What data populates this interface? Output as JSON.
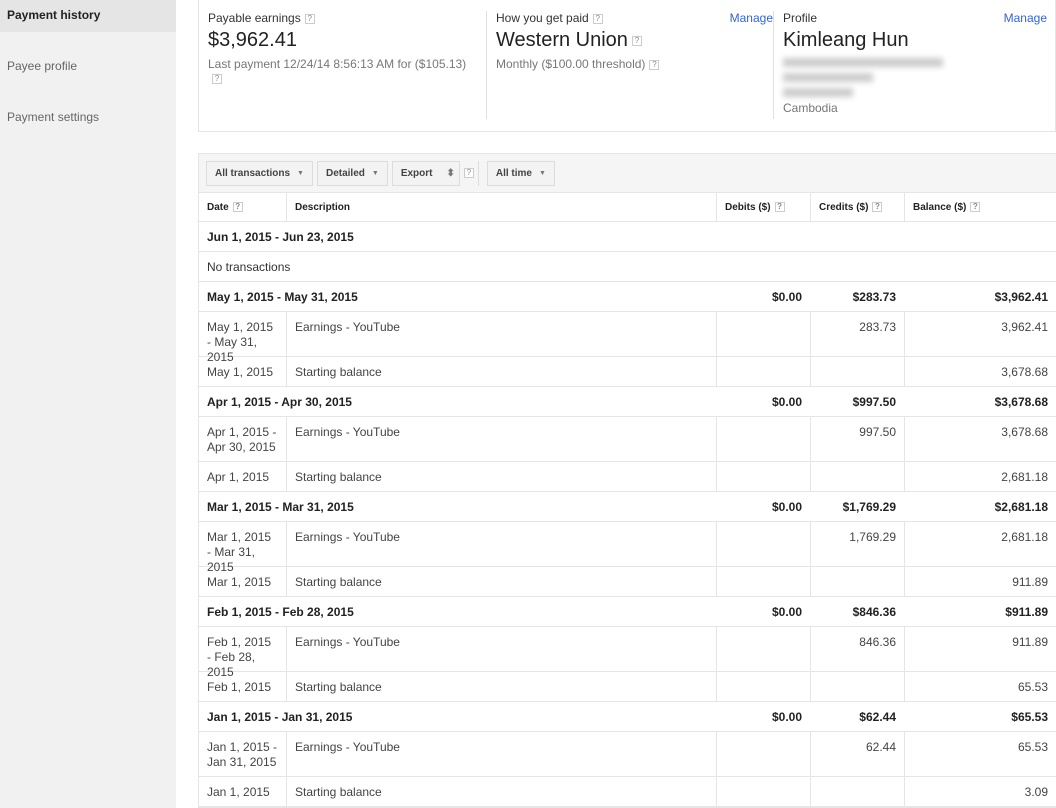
{
  "sidebar": {
    "items": [
      {
        "label": "Payment history",
        "active": true
      },
      {
        "label": "Payee profile"
      },
      {
        "label": "Payment settings"
      }
    ]
  },
  "summary": {
    "earnings": {
      "label": "Payable earnings",
      "amount": "$3,962.41",
      "last_payment": "Last payment 12/24/14 8:56:13 AM for ($105.13)"
    },
    "payment": {
      "label": "How you get paid",
      "method": "Western Union",
      "schedule": "Monthly ($100.00 threshold)",
      "manage": "Manage"
    },
    "profile": {
      "label": "Profile",
      "name": "Kimleang Hun",
      "country": "Cambodia",
      "manage": "Manage"
    }
  },
  "toolbar": {
    "transactions": "All transactions",
    "view": "Detailed",
    "export": "Export",
    "range": "All time"
  },
  "table": {
    "headers": {
      "date": "Date",
      "description": "Description",
      "debits": "Debits ($)",
      "credits": "Credits ($)",
      "balance": "Balance ($)"
    },
    "groups": [
      {
        "period": "Jun 1, 2015 - Jun 23, 2015",
        "empty": "No transactions"
      },
      {
        "period": "May 1, 2015 - May 31, 2015",
        "debits": "$0.00",
        "credits": "$283.73",
        "balance": "$3,962.41",
        "rows": [
          {
            "date": "May 1, 2015 - May 31, 2015",
            "description": "Earnings - YouTube",
            "credit": "283.73",
            "balance": "3,962.41"
          },
          {
            "date": "May 1, 2015",
            "description": "Starting balance",
            "balance": "3,678.68"
          }
        ]
      },
      {
        "period": "Apr 1, 2015 - Apr 30, 2015",
        "debits": "$0.00",
        "credits": "$997.50",
        "balance": "$3,678.68",
        "rows": [
          {
            "date": "Apr 1, 2015 - Apr 30, 2015",
            "description": "Earnings - YouTube",
            "credit": "997.50",
            "balance": "3,678.68"
          },
          {
            "date": "Apr 1, 2015",
            "description": "Starting balance",
            "balance": "2,681.18"
          }
        ]
      },
      {
        "period": "Mar 1, 2015 - Mar 31, 2015",
        "debits": "$0.00",
        "credits": "$1,769.29",
        "balance": "$2,681.18",
        "rows": [
          {
            "date": "Mar 1, 2015 - Mar 31, 2015",
            "description": "Earnings - YouTube",
            "credit": "1,769.29",
            "balance": "2,681.18"
          },
          {
            "date": "Mar 1, 2015",
            "description": "Starting balance",
            "balance": "911.89"
          }
        ]
      },
      {
        "period": "Feb 1, 2015 - Feb 28, 2015",
        "debits": "$0.00",
        "credits": "$846.36",
        "balance": "$911.89",
        "rows": [
          {
            "date": "Feb 1, 2015 - Feb 28, 2015",
            "description": "Earnings - YouTube",
            "credit": "846.36",
            "balance": "911.89"
          },
          {
            "date": "Feb 1, 2015",
            "description": "Starting balance",
            "balance": "65.53"
          }
        ]
      },
      {
        "period": "Jan 1, 2015 - Jan 31, 2015",
        "debits": "$0.00",
        "credits": "$62.44",
        "balance": "$65.53",
        "rows": [
          {
            "date": "Jan 1, 2015 - Jan 31, 2015",
            "description": "Earnings - YouTube",
            "credit": "62.44",
            "balance": "65.53"
          },
          {
            "date": "Jan 1, 2015",
            "description": "Starting balance",
            "balance": "3.09"
          }
        ]
      }
    ]
  }
}
